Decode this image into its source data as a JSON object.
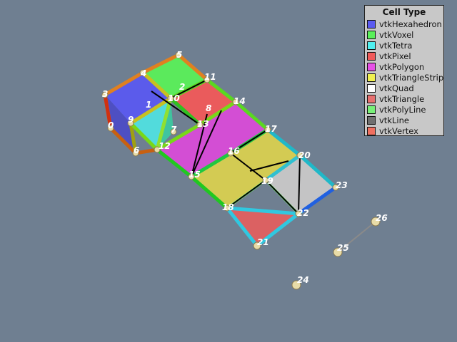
{
  "legend": {
    "title": "Cell Type",
    "items": [
      {
        "label": "vtkHexahedron",
        "color": "#5a5af0"
      },
      {
        "label": "vtkVoxel",
        "color": "#5af05a"
      },
      {
        "label": "vtkTetra",
        "color": "#50f0f0"
      },
      {
        "label": "vtkPixel",
        "color": "#f05a5a"
      },
      {
        "label": "vtkPolygon",
        "color": "#e650e6"
      },
      {
        "label": "vtkTriangleStrip",
        "color": "#f0f050"
      },
      {
        "label": "vtkQuad",
        "color": "#ffffff"
      },
      {
        "label": "vtkTriangle",
        "color": "#e87070"
      },
      {
        "label": "vtkPolyLine",
        "color": "#78f078"
      },
      {
        "label": "vtkLine",
        "color": "#707070"
      },
      {
        "label": "vtkVertex",
        "color": "#f07060"
      }
    ]
  },
  "point_labels": [
    "0",
    "1",
    "2",
    "3",
    "4",
    "5",
    "6",
    "7",
    "8",
    "9",
    "10",
    "11",
    "12",
    "13",
    "14",
    "15",
    "16",
    "17",
    "18",
    "19",
    "20",
    "21",
    "22",
    "23",
    "24",
    "25",
    "26"
  ],
  "cell_labels": [
    "1",
    "2",
    "8"
  ]
}
